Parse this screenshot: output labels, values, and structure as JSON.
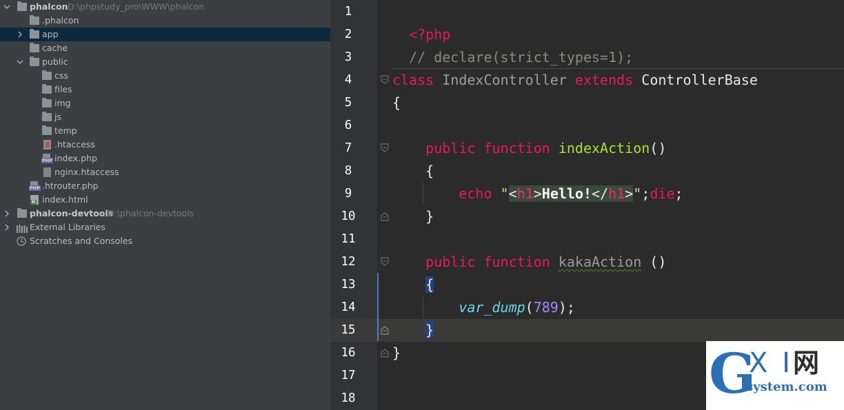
{
  "project_tree": {
    "root": {
      "name": "phalcon",
      "path": "D:\\phpstudy_pro\\WWW\\phalcon"
    },
    "items": [
      {
        "label": ".phalcon"
      },
      {
        "label": "app"
      },
      {
        "label": "cache"
      },
      {
        "label": "public"
      },
      {
        "label": "css"
      },
      {
        "label": "files"
      },
      {
        "label": "img"
      },
      {
        "label": "js"
      },
      {
        "label": "temp"
      },
      {
        "label": ".htaccess"
      },
      {
        "label": "index.php"
      },
      {
        "label": "nginx.htaccess"
      },
      {
        "label": ".htrouter.php"
      },
      {
        "label": "index.html"
      }
    ],
    "devtools": {
      "name": "phalcon-devtools",
      "path": "D:\\phalcon-devtools"
    },
    "external_libraries": "External Libraries",
    "scratches": "Scratches and Consoles",
    "php_icon_text": "PHP",
    "html_icon_text": "H"
  },
  "editor": {
    "line_numbers": [
      "1",
      "2",
      "3",
      "4",
      "5",
      "6",
      "7",
      "8",
      "9",
      "10",
      "11",
      "12",
      "13",
      "14",
      "15",
      "16",
      "17",
      "18"
    ],
    "tokens": {
      "php_open": "<?php",
      "comment": "// declare(strict_types=1);",
      "class_kw": "class",
      "class_name": "IndexController",
      "extends_kw": "extends",
      "base_class": "ControllerBase",
      "open_brace": "{",
      "close_brace": "}",
      "public_kw": "public",
      "function_kw": "function",
      "index_action": "indexAction",
      "parens": "()",
      "echo_kw": "echo",
      "quote": "\"",
      "lt": "<",
      "h1": "h1",
      "gt": ">",
      "hello": "Hello!",
      "lt_slash": "</",
      "semicolon": ";",
      "die_kw": "die",
      "kaka_action": "kakaAction",
      "space_parens": " ()",
      "var_dump": "var_dump",
      "open_paren": "(",
      "num_value": "789",
      "close_paren_semi": ");"
    },
    "current_line": "15"
  },
  "watermark": {
    "g": "G",
    "xi": "X I",
    "wang": "网",
    "domain": "system.com"
  }
}
